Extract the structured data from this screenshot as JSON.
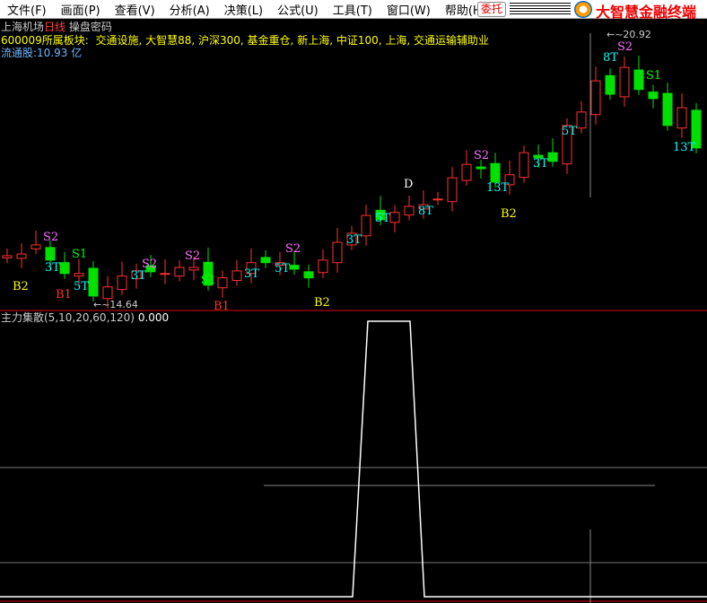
{
  "menu": [
    "文件(F)",
    "画面(P)",
    "查看(V)",
    "分析(A)",
    "决策(L)",
    "公式(U)",
    "工具(T)",
    "窗口(W)",
    "帮助(H)"
  ],
  "order_button": "委托",
  "brand": "大智慧金融终端",
  "stock": {
    "name": "上海机场",
    "period": "日线",
    "extra": "操盘密码",
    "sector_label": "600009所属板块:",
    "sectors": "交通设施, 大智慧88, 沪深300, 基金重仓, 新上海, 中证100, 上海, 交通运输辅助业",
    "float_shares": "流通股:10.93 亿"
  },
  "price_high_label": "20.92",
  "price_low_label": "14.64",
  "indicator": {
    "name": "主力集散(5,10,20,60,120)",
    "value": "0.000"
  },
  "colors": {
    "up": "#ff3030",
    "down": "#00e000",
    "bg": "#000000",
    "separator": "#e00000"
  },
  "chart_data": {
    "type": "candlestick",
    "price_range": [
      14.64,
      20.92
    ],
    "closes": [
      15.78,
      15.82,
      16.03,
      15.68,
      15.37,
      15.37,
      14.85,
      15.06,
      15.31,
      15.43,
      15.41,
      15.37,
      15.51,
      15.51,
      15.1,
      15.27,
      15.43,
      15.62,
      15.62,
      15.62,
      15.47,
      15.27,
      15.68,
      16.09,
      16.3,
      16.71,
      16.61,
      16.78,
      16.92,
      16.96,
      17.09,
      17.58,
      17.89,
      17.79,
      17.48,
      17.65,
      18.16,
      18.04,
      17.96,
      18.79,
      19.1,
      19.82,
      19.51,
      20.13,
      19.62,
      19.41,
      18.79,
      19.2,
      18.27
    ],
    "labels": [
      {
        "t": "S2",
        "c": "#ff70ff"
      },
      {
        "t": "S1",
        "c": "#00ff00"
      },
      {
        "t": "B1",
        "c": "#ff3030"
      },
      {
        "t": "B2",
        "c": "#ffff00"
      },
      {
        "t": "3T",
        "c": "#00ffff"
      },
      {
        "t": "5T",
        "c": "#00ffff"
      },
      {
        "t": "S2",
        "c": "#ff70ff"
      },
      {
        "t": "S2",
        "c": "#ff70ff"
      },
      {
        "t": "S1",
        "c": "#00ff00"
      },
      {
        "t": "B1",
        "c": "#ff3030"
      },
      {
        "t": "3T",
        "c": "#00ffff"
      },
      {
        "t": "S2",
        "c": "#ff70ff"
      },
      {
        "t": "5T",
        "c": "#00ffff"
      },
      {
        "t": "B2",
        "c": "#ffff00"
      },
      {
        "t": "3T",
        "c": "#00ffff"
      },
      {
        "t": "5T",
        "c": "#00ffff"
      },
      {
        "t": "D",
        "c": "#ffffff"
      },
      {
        "t": "8T",
        "c": "#00ffff"
      },
      {
        "t": "S2",
        "c": "#ff70ff"
      },
      {
        "t": "13T",
        "c": "#00ffff"
      },
      {
        "t": "B2",
        "c": "#ffff00"
      },
      {
        "t": "3T",
        "c": "#00ffff"
      },
      {
        "t": "5T",
        "c": "#00ffff"
      },
      {
        "t": "8T",
        "c": "#00ffff"
      },
      {
        "t": "S2",
        "c": "#ff70ff"
      },
      {
        "t": "S1",
        "c": "#00ff00"
      },
      {
        "t": "13T",
        "c": "#00ffff"
      },
      {
        "t": "3T",
        "c": "#00ffff"
      }
    ],
    "indicator_series": "0 until rise, peak plateau, back to 0"
  }
}
